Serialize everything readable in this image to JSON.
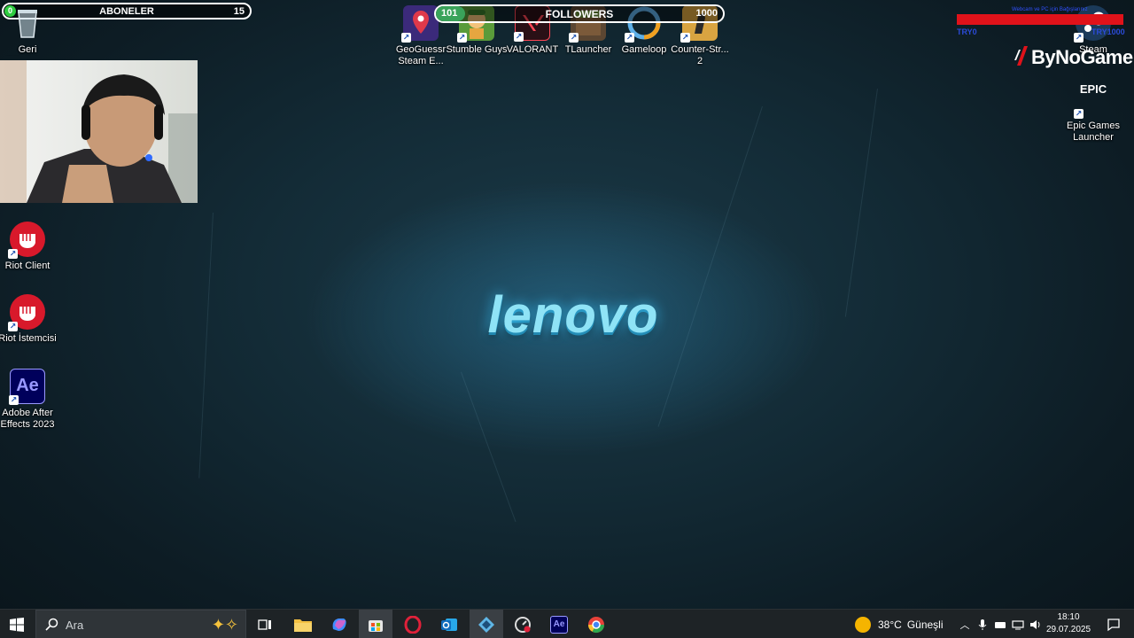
{
  "overlays": {
    "subscribers": {
      "label": "ABONELER",
      "current": "0",
      "goal": "15"
    },
    "followers": {
      "label": "FOLLOWERS",
      "current": "101",
      "goal": "1000",
      "progress": 0.101
    },
    "red_bar": {
      "top_text": "Webcam ve PC için Bağışlarınız",
      "left_text": "TRY0",
      "right_text": "TRY1000"
    },
    "watermark": "ByNoGame"
  },
  "wallpaper": {
    "brand": "lenovo"
  },
  "desktop_icons": {
    "recycle_bin": "Geri Dönüşü...",
    "riot_client": "Riot Client",
    "riot_istemcisi": "Riot İstemcisi",
    "after_effects": "Adobe After Effects 2023",
    "after_effects_glyph": "Ae",
    "geoguessr": "GeoGuessr Steam E...",
    "stumble_guys": "Stumble Guys",
    "valorant": "VALORANT",
    "tlauncher": "TLauncher",
    "gameloop": "Gameloop",
    "counter_strike": "Counter-Str... 2",
    "steam": "Steam",
    "epic_games": "Epic Games Launcher",
    "epic_glyph": "EPIC"
  },
  "taskbar": {
    "search_placeholder": "Ara",
    "weather_temp": "38°C",
    "weather_text": "Güneşli",
    "time": "18:10",
    "date": "29.07.2025"
  },
  "colors": {
    "accent_red": "#e0121a",
    "followers_green": "#3aa35a",
    "taskbar": "#1e2326"
  }
}
